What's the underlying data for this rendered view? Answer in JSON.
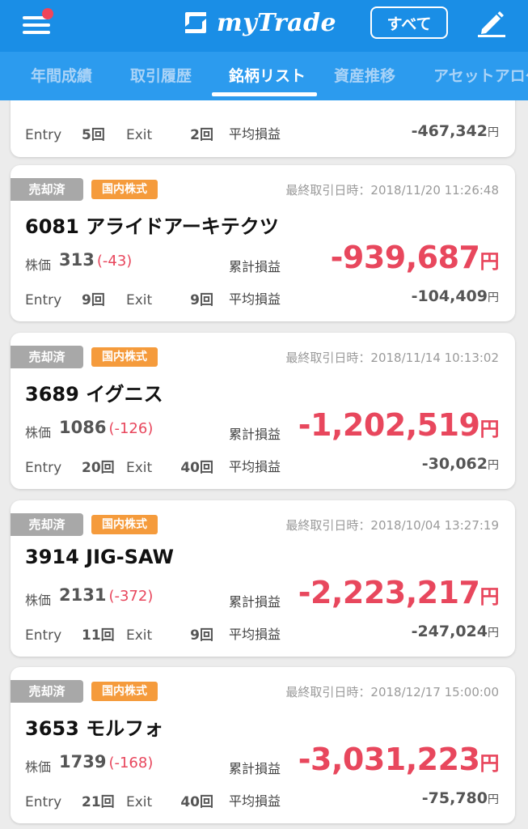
{
  "header": {
    "app_name": "myTrade",
    "all_button": "すべて"
  },
  "tabs": [
    {
      "label": "年間成績"
    },
    {
      "label": "取引履歴"
    },
    {
      "label": "銘柄リスト"
    },
    {
      "label": "資産推移"
    },
    {
      "label": "アセットアロケ"
    }
  ],
  "colors": {
    "header_blue": "#1a8ee6",
    "loss_red": "#e8475d",
    "sold_badge": "#a8a8a8",
    "domestic_badge": "#f59b3c"
  },
  "labels": {
    "price": "株価",
    "cumulative_pnl": "累計損益",
    "average_pnl": "平均損益",
    "entry": "Entry",
    "exit": "Exit",
    "yen": "円"
  },
  "partial_card": {
    "entry_count": "5回",
    "exit_count": "2回",
    "average_pnl": "-467,342"
  },
  "cards": [
    {
      "status": "売却済",
      "market": "国内株式",
      "last_trade": "最終取引日時：2018/11/20 11:26:48",
      "name": "6081 アライドアーキテクツ",
      "price": "313",
      "price_change": "(-43)",
      "cumulative_pnl": "-939,687",
      "entry_count": "9回",
      "exit_count": "9回",
      "average_pnl": "-104,409"
    },
    {
      "status": "売却済",
      "market": "国内株式",
      "last_trade": "最終取引日時：2018/11/14 10:13:02",
      "name": "3689 イグニス",
      "price": "1086",
      "price_change": "(-126)",
      "cumulative_pnl": "-1,202,519",
      "entry_count": "20回",
      "exit_count": "40回",
      "average_pnl": "-30,062"
    },
    {
      "status": "売却済",
      "market": "国内株式",
      "last_trade": "最終取引日時：2018/10/04 13:27:19",
      "name": "3914 JIG-SAW",
      "price": "2131",
      "price_change": "(-372)",
      "cumulative_pnl": "-2,223,217",
      "entry_count": "11回",
      "exit_count": "9回",
      "average_pnl": "-247,024"
    },
    {
      "status": "売却済",
      "market": "国内株式",
      "last_trade": "最終取引日時：2018/12/17 15:00:00",
      "name": "3653 モルフォ",
      "price": "1739",
      "price_change": "(-168)",
      "cumulative_pnl": "-3,031,223",
      "entry_count": "21回",
      "exit_count": "40回",
      "average_pnl": "-75,780"
    }
  ]
}
